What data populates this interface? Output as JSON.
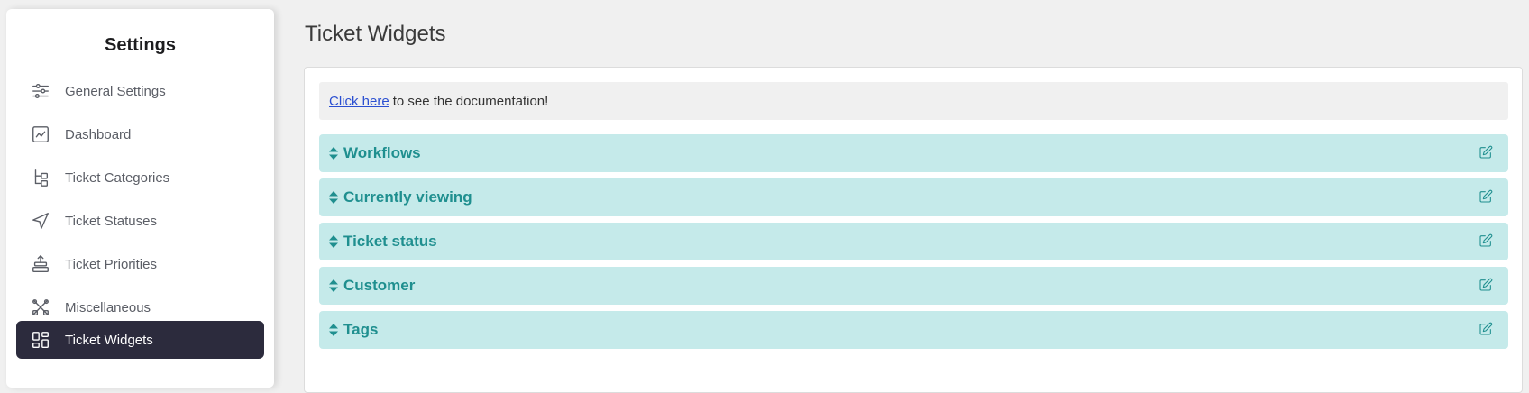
{
  "sidebar": {
    "title": "Settings",
    "items": [
      {
        "label": "General Settings",
        "icon": "sliders-icon"
      },
      {
        "label": "Dashboard",
        "icon": "chart-icon"
      },
      {
        "label": "Ticket Categories",
        "icon": "hierarchy-icon"
      },
      {
        "label": "Ticket Statuses",
        "icon": "send-icon"
      },
      {
        "label": "Ticket Priorities",
        "icon": "priority-stack-icon"
      },
      {
        "label": "Miscellaneous",
        "icon": "tools-icon"
      },
      {
        "label": "Ticket Widgets",
        "icon": "grid-icon",
        "active": true
      }
    ]
  },
  "main": {
    "title": "Ticket Widgets",
    "doc": {
      "link": "Click here",
      "text": "to see the documentation!"
    },
    "widgets": [
      {
        "label": "Workflows"
      },
      {
        "label": "Currently viewing"
      },
      {
        "label": "Ticket status"
      },
      {
        "label": "Customer"
      },
      {
        "label": "Tags"
      }
    ]
  },
  "colors": {
    "active_bg": "#2c2b3d",
    "widget_bg": "#c5eaea",
    "widget_text": "#1f8f8f",
    "link": "#2b4fd1"
  }
}
